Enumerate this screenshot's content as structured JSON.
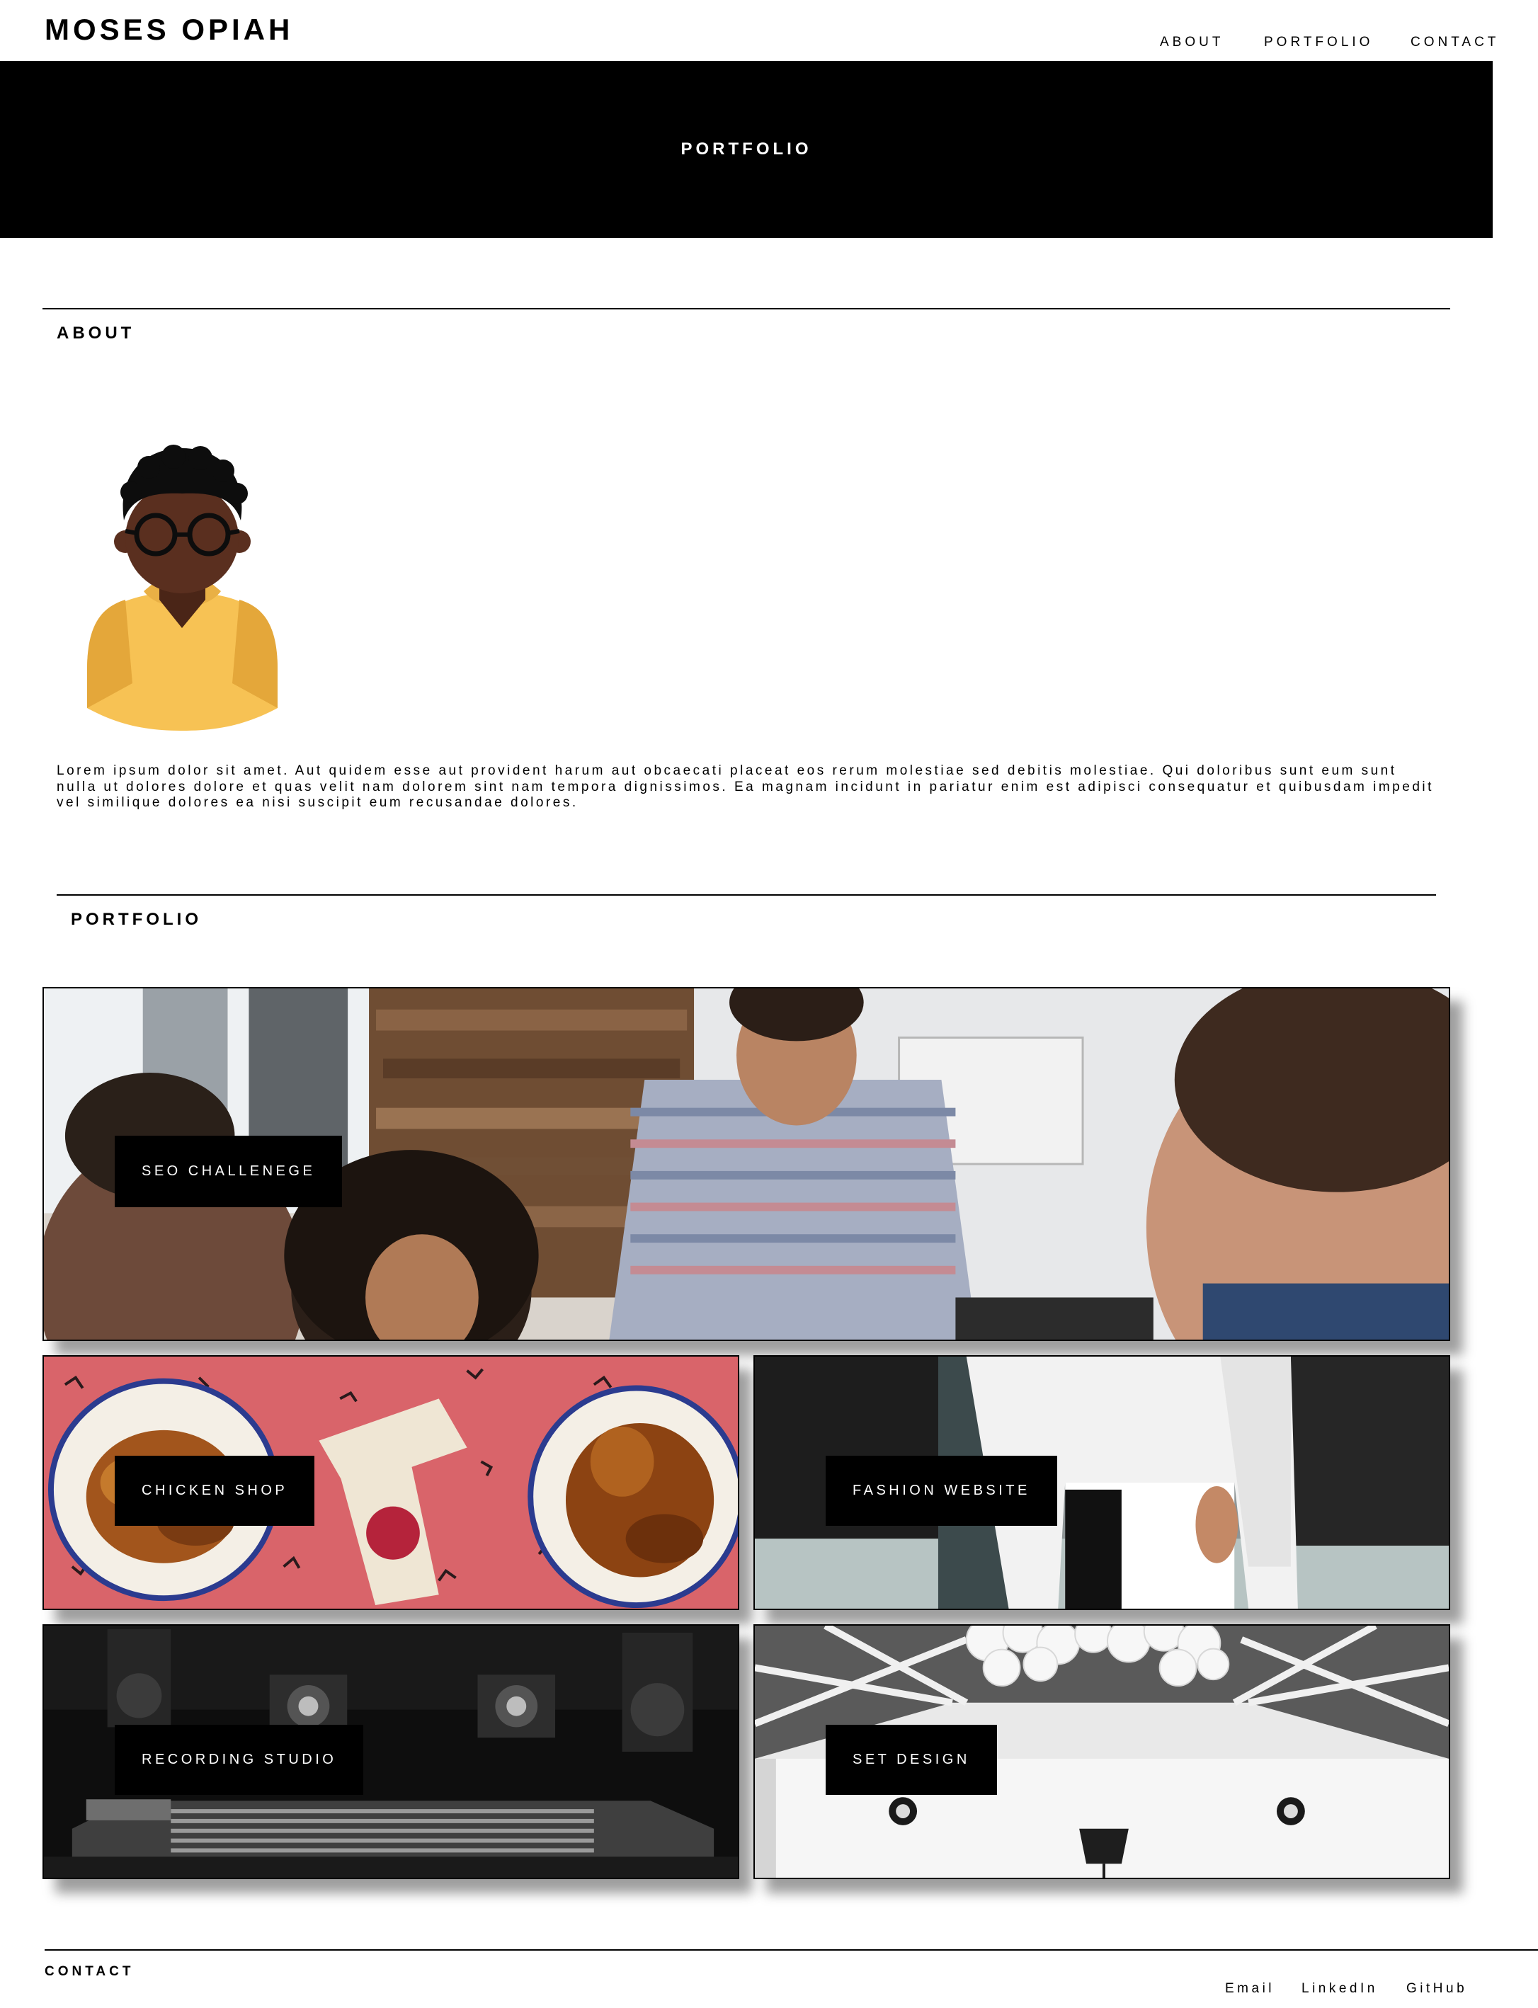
{
  "header": {
    "site_title": "MOSES OPIAH",
    "nav": [
      "ABOUT",
      "PORTFOLIO",
      "CONTACT"
    ]
  },
  "hero": {
    "title": "PORTFOLIO"
  },
  "about": {
    "heading": "ABOUT",
    "avatar_icon": "person-avatar-icon",
    "text": "Lorem ipsum dolor sit amet. Aut quidem esse aut provident harum aut obcaecati placeat eos rerum molestiae sed debitis molestiae. Qui doloribus sunt eum sunt nulla ut dolores dolore et quas velit nam dolorem sint nam tempora dignissimos. Ea magnam incidunt in pariatur enim est adipisci consequatur et quibusdam impedit vel similique dolores ea nisi suscipit eum recusandae dolores."
  },
  "portfolio": {
    "heading": "PORTFOLIO",
    "projects": [
      {
        "label": "SEO CHALLENEGE"
      },
      {
        "label": "CHICKEN SHOP"
      },
      {
        "label": "FASHION WEBSITE"
      },
      {
        "label": "RECORDING STUDIO"
      },
      {
        "label": "SET DESIGN"
      }
    ]
  },
  "footer": {
    "heading": "CONTACT",
    "links": [
      "Email",
      "LinkedIn",
      "GitHub"
    ]
  },
  "colors": {
    "primary": "#000000",
    "background": "#ffffff",
    "avatar_shirt": "#f7c254",
    "avatar_skin": "#5a2f1f"
  }
}
